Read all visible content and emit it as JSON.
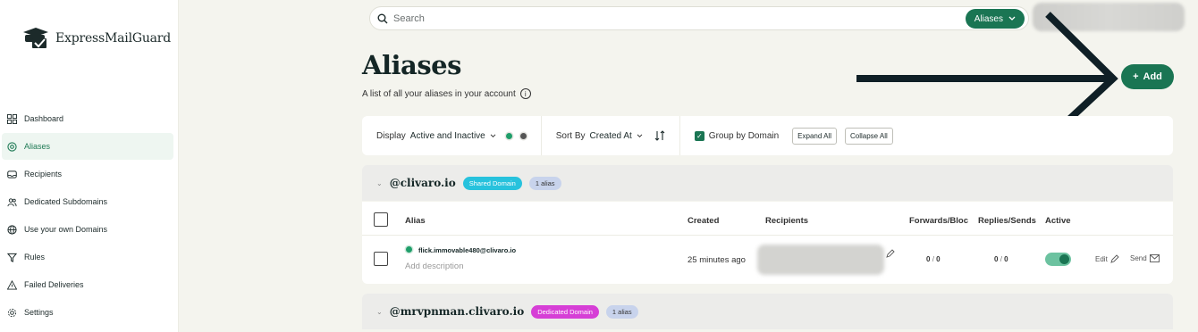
{
  "app": {
    "brand": "ExpressMailGuard"
  },
  "sidebar": {
    "items": [
      {
        "label": "Dashboard",
        "icon": "grid-icon",
        "active": false
      },
      {
        "label": "Aliases",
        "icon": "at-icon",
        "active": true
      },
      {
        "label": "Recipients",
        "icon": "inbox-icon",
        "active": false
      },
      {
        "label": "Dedicated Subdomains",
        "icon": "users-icon",
        "active": false
      },
      {
        "label": "Use your own Domains",
        "icon": "globe-icon",
        "active": false
      },
      {
        "label": "Rules",
        "icon": "filter-icon",
        "active": false
      },
      {
        "label": "Failed Deliveries",
        "icon": "warning-icon",
        "active": false
      },
      {
        "label": "Settings",
        "icon": "gear-icon",
        "active": false
      }
    ]
  },
  "search": {
    "placeholder": "Search",
    "scope": "Aliases"
  },
  "page": {
    "title": "Aliases",
    "subtitle": "A list of all your aliases in your account",
    "add_label": "Add"
  },
  "filters": {
    "display_prefix": "Display",
    "display_value": "Active and Inactive",
    "sort_prefix": "Sort By",
    "sort_value": "Created At",
    "group_by_domain": "Group by Domain",
    "expand_all": "Expand All",
    "collapse_all": "Collapse All"
  },
  "groups": [
    {
      "domain": "@clivaro.io",
      "type": "Shared Domain",
      "type_color": "#27c2dd",
      "count": "1 alias"
    },
    {
      "domain": "@mrvpnman.clivaro.io",
      "type": "Dedicated Domain",
      "type_color": "#d63fd6",
      "count": "1 alias"
    }
  ],
  "table": {
    "columns": [
      "Alias",
      "Created",
      "Recipients",
      "Forwards/Bloc",
      "Replies/Sends",
      "Active"
    ],
    "rows": [
      {
        "alias": "flick.immovable480@clivaro.io",
        "description": "Add description",
        "created": "25 minutes ago",
        "forwards": "0",
        "blocked": "0",
        "replies": "0",
        "sends": "0",
        "active": true,
        "edit_label": "Edit",
        "send_label": "Send"
      }
    ]
  },
  "colors": {
    "accent": "#1a7553",
    "background": "#f4f4ee"
  }
}
